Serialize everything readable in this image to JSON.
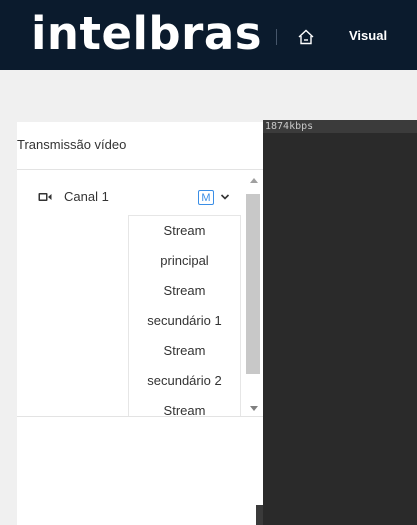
{
  "header": {
    "logo_text": "intelbras",
    "nav_label": "Visual",
    "home_icon": "home-icon"
  },
  "sidebar": {
    "title": "Transmissão vídeo",
    "channel": {
      "icon": "camera-icon",
      "label": "Canal 1",
      "stream_badge": "M"
    },
    "stream_options": [
      "Stream",
      "principal",
      "Stream",
      "secundário 1",
      "Stream",
      "secundário 2",
      "Stream"
    ]
  },
  "video": {
    "bitrate": "1874kbps"
  },
  "colors": {
    "topbar": "#0b1b2d",
    "accent": "#3a8ee6",
    "video_bg": "#2a2a2a"
  }
}
